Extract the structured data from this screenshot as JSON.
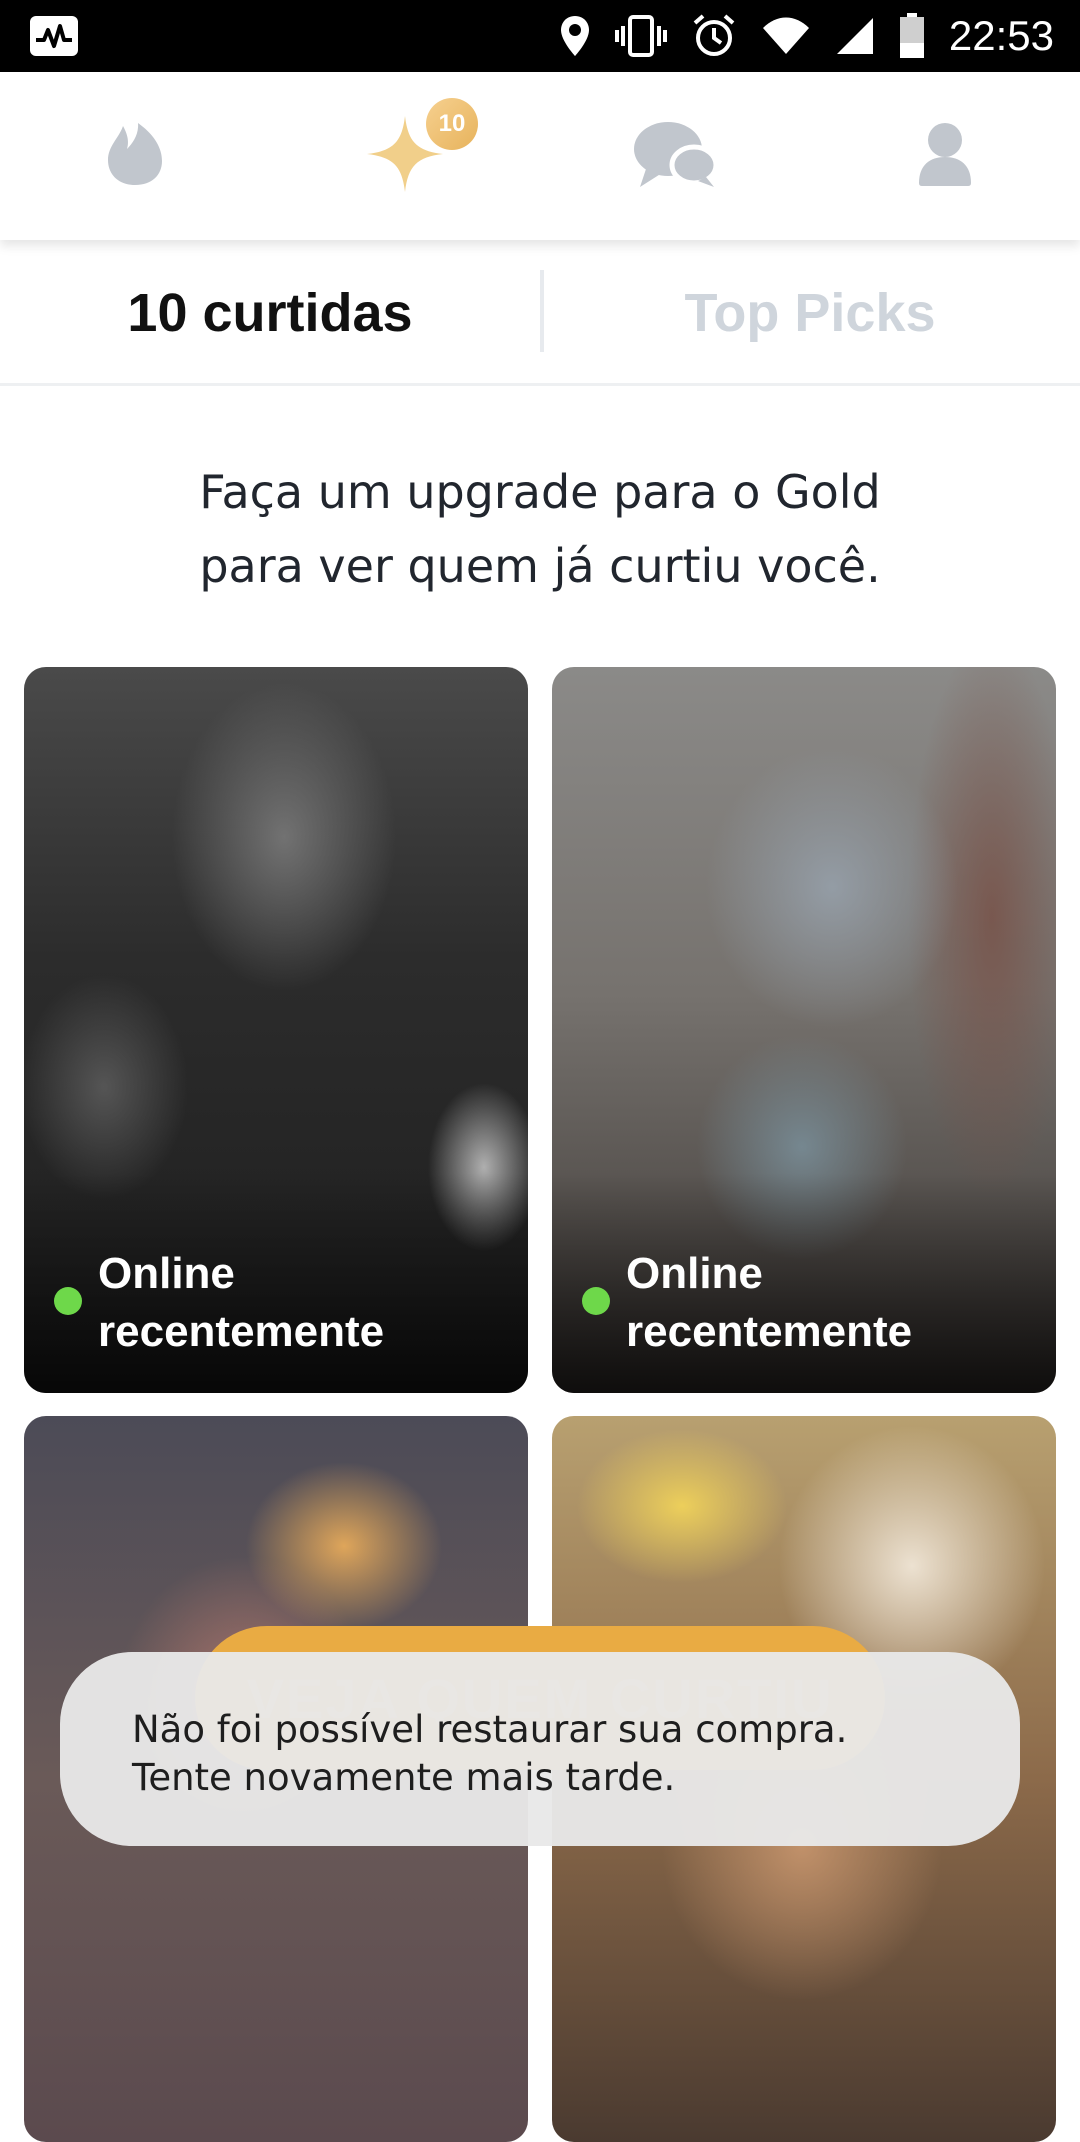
{
  "status_bar": {
    "time": "22:53",
    "icons": [
      "activity-icon",
      "location-icon",
      "vibrate-icon",
      "alarm-icon",
      "wifi-icon",
      "signal-icon",
      "battery-icon"
    ]
  },
  "nav": {
    "items": [
      "flame-icon",
      "gold-star-icon",
      "chat-icon",
      "profile-icon"
    ],
    "likes_badge": "10",
    "colors": {
      "inactive": "#c1c6cd",
      "gold": "#f1cf8a",
      "badge": "#e9b45f"
    }
  },
  "tabs": {
    "likes": "10 curtidas",
    "top_picks": "Top Picks"
  },
  "upgrade_message": {
    "line1": "Faça um upgrade para o Gold",
    "line2": "para ver quem já curtiu você."
  },
  "cards": [
    {
      "status_line1": "Online",
      "status_line2": "recentemente"
    },
    {
      "status_line1": "Online",
      "status_line2": "recentemente"
    }
  ],
  "cta": {
    "label": "VEJA QUEM CURTIU"
  },
  "toast": {
    "line1": "Não foi possível restaurar sua compra.",
    "line2": "Tente novamente mais tarde."
  }
}
